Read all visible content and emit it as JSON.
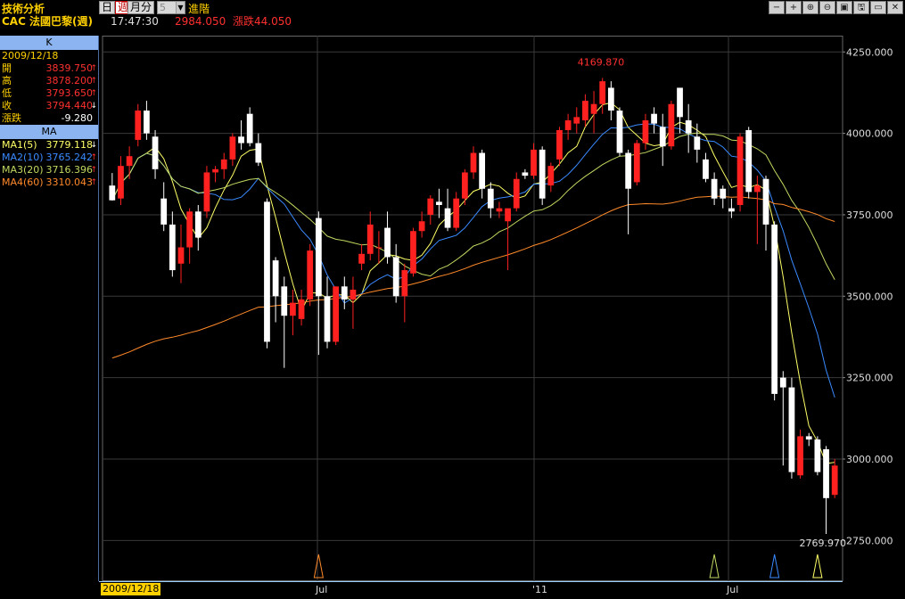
{
  "toolbar": {
    "title": "技術分析",
    "day": "日",
    "week": "週",
    "month": "月",
    "minute": "分",
    "interval_value": "5",
    "advanced": "進階",
    "window_buttons": [
      "−",
      "+",
      "⊕",
      "⊖",
      "▣",
      "🖫",
      "▭",
      "✕"
    ]
  },
  "info": {
    "symbol": "CAC",
    "name": "法國巴黎(週)",
    "time": "17:47:30",
    "price": "2984.050",
    "change": "漲跌44.050"
  },
  "panel": {
    "k_header": "K",
    "date": "2009/12/18",
    "open_label": "開",
    "open_value": "3839.750",
    "high_label": "高",
    "high_value": "3878.200",
    "low_label": "低",
    "low_value": "3793.650",
    "close_label": "收",
    "close_value": "3794.440",
    "chg_label": "漲跌",
    "chg_value": "-9.280",
    "ma_header": "MA",
    "ma1_label": "MA1(5)",
    "ma1_value": "3779.118",
    "ma2_label": "MA2(10)",
    "ma2_value": "3765.242",
    "ma3_label": "MA3(20)",
    "ma3_value": "3716.396",
    "ma4_label": "MA4(60)",
    "ma4_value": "3310.043"
  },
  "colors": {
    "up": "#ff2020",
    "down": "#ffffff",
    "ma5": "#ffff66",
    "ma10": "#3a8aff",
    "ma20": "#c0d860",
    "ma60": "#ff8a2a",
    "grid": "#3a3a3a"
  },
  "chart_data": {
    "type": "candlestick",
    "title": "CAC 法國巴黎(週)",
    "ylim": [
      2625,
      4300
    ],
    "y_ticks": [
      "4250.000",
      "4000.000",
      "3750.000",
      "3500.000",
      "3250.000",
      "3000.000",
      "2750.000"
    ],
    "x_ticks": [
      "2009/12/18",
      "Jul",
      "'11",
      "Jul"
    ],
    "annotations": {
      "high": "4169.870",
      "low": "2769.970"
    },
    "candles": [
      {
        "o": 3839.75,
        "h": 3878.2,
        "l": 3793.65,
        "c": 3794.44
      },
      {
        "o": 3800,
        "h": 3930,
        "l": 3780,
        "c": 3900
      },
      {
        "o": 3900,
        "h": 3960,
        "l": 3860,
        "c": 3930
      },
      {
        "o": 3980,
        "h": 4090,
        "l": 3960,
        "c": 4070
      },
      {
        "o": 4070,
        "h": 4100,
        "l": 3980,
        "c": 4000
      },
      {
        "o": 3990,
        "h": 4010,
        "l": 3860,
        "c": 3890
      },
      {
        "o": 3800,
        "h": 3850,
        "l": 3700,
        "c": 3720
      },
      {
        "o": 3720,
        "h": 3760,
        "l": 3560,
        "c": 3580
      },
      {
        "o": 3600,
        "h": 3720,
        "l": 3540,
        "c": 3650
      },
      {
        "o": 3650,
        "h": 3770,
        "l": 3600,
        "c": 3760
      },
      {
        "o": 3760,
        "h": 3780,
        "l": 3640,
        "c": 3680
      },
      {
        "o": 3760,
        "h": 3900,
        "l": 3740,
        "c": 3880
      },
      {
        "o": 3880,
        "h": 3900,
        "l": 3850,
        "c": 3890
      },
      {
        "o": 3890,
        "h": 3940,
        "l": 3860,
        "c": 3920
      },
      {
        "o": 3920,
        "h": 4000,
        "l": 3900,
        "c": 3990
      },
      {
        "o": 3990,
        "h": 4040,
        "l": 3950,
        "c": 3970
      },
      {
        "o": 4060,
        "h": 4080,
        "l": 3960,
        "c": 3970
      },
      {
        "o": 3970,
        "h": 4000,
        "l": 3900,
        "c": 3910
      },
      {
        "o": 3790,
        "h": 3800,
        "l": 3340,
        "c": 3360
      },
      {
        "o": 3610,
        "h": 3620,
        "l": 3420,
        "c": 3500
      },
      {
        "o": 3530,
        "h": 3560,
        "l": 3280,
        "c": 3440
      },
      {
        "o": 3440,
        "h": 3520,
        "l": 3380,
        "c": 3480
      },
      {
        "o": 3430,
        "h": 3520,
        "l": 3410,
        "c": 3490
      },
      {
        "o": 3490,
        "h": 3660,
        "l": 3470,
        "c": 3640
      },
      {
        "o": 3740,
        "h": 3760,
        "l": 3320,
        "c": 3500
      },
      {
        "o": 3500,
        "h": 3560,
        "l": 3340,
        "c": 3360
      },
      {
        "o": 3360,
        "h": 3530,
        "l": 3350,
        "c": 3530
      },
      {
        "o": 3530,
        "h": 3560,
        "l": 3460,
        "c": 3490
      },
      {
        "o": 3490,
        "h": 3560,
        "l": 3400,
        "c": 3520
      },
      {
        "o": 3600,
        "h": 3660,
        "l": 3580,
        "c": 3630
      },
      {
        "o": 3630,
        "h": 3760,
        "l": 3610,
        "c": 3720
      },
      {
        "o": 3650,
        "h": 3700,
        "l": 3600,
        "c": 3650
      },
      {
        "o": 3710,
        "h": 3760,
        "l": 3600,
        "c": 3620
      },
      {
        "o": 3620,
        "h": 3660,
        "l": 3480,
        "c": 3500
      },
      {
        "o": 3500,
        "h": 3600,
        "l": 3420,
        "c": 3580
      },
      {
        "o": 3570,
        "h": 3710,
        "l": 3560,
        "c": 3700
      },
      {
        "o": 3700,
        "h": 3760,
        "l": 3680,
        "c": 3730
      },
      {
        "o": 3750,
        "h": 3810,
        "l": 3720,
        "c": 3800
      },
      {
        "o": 3790,
        "h": 3830,
        "l": 3740,
        "c": 3780
      },
      {
        "o": 3770,
        "h": 3830,
        "l": 3700,
        "c": 3710
      },
      {
        "o": 3710,
        "h": 3820,
        "l": 3700,
        "c": 3800
      },
      {
        "o": 3800,
        "h": 3890,
        "l": 3780,
        "c": 3880
      },
      {
        "o": 3880,
        "h": 3960,
        "l": 3860,
        "c": 3940
      },
      {
        "o": 3940,
        "h": 3950,
        "l": 3800,
        "c": 3830
      },
      {
        "o": 3830,
        "h": 3850,
        "l": 3740,
        "c": 3770
      },
      {
        "o": 3760,
        "h": 3790,
        "l": 3740,
        "c": 3770
      },
      {
        "o": 3730,
        "h": 3760,
        "l": 3580,
        "c": 3770
      },
      {
        "o": 3770,
        "h": 3880,
        "l": 3760,
        "c": 3860
      },
      {
        "o": 3880,
        "h": 3890,
        "l": 3860,
        "c": 3870
      },
      {
        "o": 3870,
        "h": 3970,
        "l": 3860,
        "c": 3950
      },
      {
        "o": 3950,
        "h": 3960,
        "l": 3780,
        "c": 3800
      },
      {
        "o": 3840,
        "h": 3910,
        "l": 3820,
        "c": 3900
      },
      {
        "o": 3920,
        "h": 4020,
        "l": 3900,
        "c": 4010
      },
      {
        "o": 4010,
        "h": 4060,
        "l": 3980,
        "c": 4040
      },
      {
        "o": 4030,
        "h": 4080,
        "l": 4000,
        "c": 4050
      },
      {
        "o": 4040,
        "h": 4120,
        "l": 4020,
        "c": 4100
      },
      {
        "o": 4060,
        "h": 4130,
        "l": 4000,
        "c": 4090
      },
      {
        "o": 4090,
        "h": 4170,
        "l": 4060,
        "c": 4160
      },
      {
        "o": 4140,
        "h": 4160,
        "l": 4040,
        "c": 4070
      },
      {
        "o": 4070,
        "h": 4080,
        "l": 3930,
        "c": 3940
      },
      {
        "o": 3940,
        "h": 3950,
        "l": 3690,
        "c": 3830
      },
      {
        "o": 3850,
        "h": 3980,
        "l": 3840,
        "c": 3970
      },
      {
        "o": 3970,
        "h": 4060,
        "l": 3950,
        "c": 4040
      },
      {
        "o": 4060,
        "h": 4080,
        "l": 4000,
        "c": 4030
      },
      {
        "o": 4020,
        "h": 4060,
        "l": 3900,
        "c": 3960
      },
      {
        "o": 3960,
        "h": 4100,
        "l": 3950,
        "c": 4090
      },
      {
        "o": 4140,
        "h": 4140,
        "l": 4000,
        "c": 4050
      },
      {
        "o": 4040,
        "h": 4090,
        "l": 3940,
        "c": 4000
      },
      {
        "o": 3990,
        "h": 4030,
        "l": 3910,
        "c": 3950
      },
      {
        "o": 3920,
        "h": 3940,
        "l": 3850,
        "c": 3860
      },
      {
        "o": 3860,
        "h": 3880,
        "l": 3780,
        "c": 3800
      },
      {
        "o": 3830,
        "h": 3840,
        "l": 3770,
        "c": 3800
      },
      {
        "o": 3770,
        "h": 3800,
        "l": 3740,
        "c": 3760
      },
      {
        "o": 3780,
        "h": 4000,
        "l": 3760,
        "c": 3990
      },
      {
        "o": 4010,
        "h": 4020,
        "l": 3800,
        "c": 3820
      },
      {
        "o": 3820,
        "h": 3870,
        "l": 3660,
        "c": 3840
      },
      {
        "o": 3860,
        "h": 3870,
        "l": 3640,
        "c": 3720
      },
      {
        "o": 3720,
        "h": 3730,
        "l": 3180,
        "c": 3200
      },
      {
        "o": 3250,
        "h": 3270,
        "l": 2980,
        "c": 3220
      },
      {
        "o": 3220,
        "h": 3250,
        "l": 2940,
        "c": 2960
      },
      {
        "o": 2950,
        "h": 3090,
        "l": 2940,
        "c": 3070
      },
      {
        "o": 3070,
        "h": 3080,
        "l": 3040,
        "c": 3060
      },
      {
        "o": 3060,
        "h": 3070,
        "l": 2950,
        "c": 2960
      },
      {
        "o": 3030,
        "h": 3040,
        "l": 2770,
        "c": 2880
      },
      {
        "o": 2890,
        "h": 3000,
        "l": 2880,
        "c": 2980
      }
    ],
    "markers": [
      {
        "index": 24,
        "color": "#ff8a2a"
      },
      {
        "index": 70,
        "color": "#c0d860"
      },
      {
        "index": 77,
        "color": "#3a8aff"
      },
      {
        "index": 82,
        "color": "#ffff66"
      }
    ]
  }
}
